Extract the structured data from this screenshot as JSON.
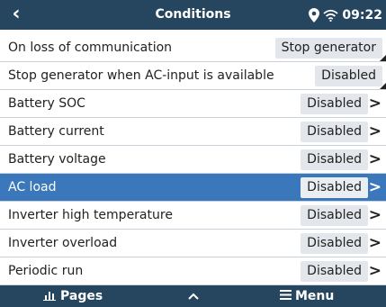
{
  "header": {
    "title": "Conditions",
    "back_icon": "chevron-left-icon",
    "location_icon": "location-pin-icon",
    "wifi_icon": "wifi-icon",
    "time": "09:22"
  },
  "rows": [
    {
      "label": "On loss of communication",
      "value": "Stop generator",
      "chevron": false,
      "selected": false
    },
    {
      "label": "Stop generator when AC-input is available",
      "value": "Disabled",
      "chevron": false,
      "selected": false
    },
    {
      "label": "Battery SOC",
      "value": "Disabled",
      "chevron": true,
      "selected": false
    },
    {
      "label": "Battery current",
      "value": "Disabled",
      "chevron": true,
      "selected": false
    },
    {
      "label": "Battery voltage",
      "value": "Disabled",
      "chevron": true,
      "selected": false
    },
    {
      "label": "AC load",
      "value": "Disabled",
      "chevron": true,
      "selected": true
    },
    {
      "label": "Inverter high temperature",
      "value": "Disabled",
      "chevron": true,
      "selected": false
    },
    {
      "label": "Inverter overload",
      "value": "Disabled",
      "chevron": true,
      "selected": false
    },
    {
      "label": "Periodic run",
      "value": "Disabled",
      "chevron": true,
      "selected": false
    }
  ],
  "chevron_glyph": ">",
  "footer": {
    "pages_label": "Pages",
    "pages_icon": "bar-chart-icon",
    "up_icon": "chevron-up-icon",
    "menu_label": "Menu",
    "menu_icon": "hamburger-menu-icon"
  },
  "colors": {
    "header_bg": "#26455e",
    "selected_row": "#3a78bb",
    "value_box": "#e3e7eb"
  }
}
